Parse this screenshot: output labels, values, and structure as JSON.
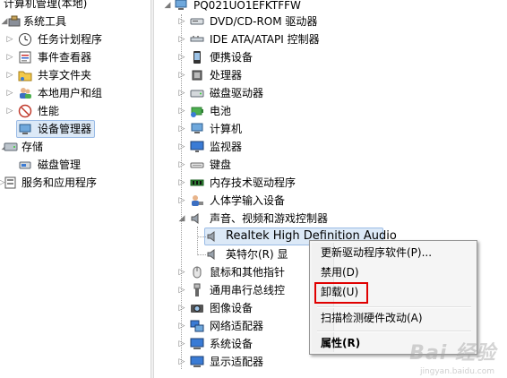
{
  "left_tree": {
    "title": "计算机管理(本地)",
    "items": [
      {
        "label": "系统工具",
        "arrow": "◢",
        "icon": "tools-icon"
      },
      {
        "label": "任务计划程序",
        "arrow": "▷",
        "icon": "clock-icon"
      },
      {
        "label": "事件查看器",
        "arrow": "▷",
        "icon": "event-viewer-icon"
      },
      {
        "label": "共享文件夹",
        "arrow": "▷",
        "icon": "shared-folder-icon"
      },
      {
        "label": "本地用户和组",
        "arrow": "▷",
        "icon": "users-icon"
      },
      {
        "label": "性能",
        "arrow": "▷",
        "icon": "performance-icon"
      },
      {
        "label": "设备管理器",
        "arrow": "",
        "icon": "device-manager-icon"
      },
      {
        "label": "存储",
        "arrow": "◢",
        "icon": "storage-icon"
      },
      {
        "label": "磁盘管理",
        "arrow": "",
        "icon": "disk-management-icon"
      },
      {
        "label": "服务和应用程序",
        "arrow": "▷",
        "icon": "services-icon"
      }
    ]
  },
  "device_tree": {
    "root": "PQ021UO1EFKTFFW",
    "items": [
      {
        "label": "DVD/CD-ROM 驱动器",
        "arrow": "▷",
        "icon": "dvd-drive-icon"
      },
      {
        "label": "IDE ATA/ATAPI 控制器",
        "arrow": "▷",
        "icon": "ide-controller-icon"
      },
      {
        "label": "便携设备",
        "arrow": "▷",
        "icon": "portable-device-icon"
      },
      {
        "label": "处理器",
        "arrow": "▷",
        "icon": "processor-icon"
      },
      {
        "label": "磁盘驱动器",
        "arrow": "▷",
        "icon": "disk-drive-icon"
      },
      {
        "label": "电池",
        "arrow": "▷",
        "icon": "battery-icon"
      },
      {
        "label": "计算机",
        "arrow": "▷",
        "icon": "computer-icon"
      },
      {
        "label": "监视器",
        "arrow": "▷",
        "icon": "monitor-icon"
      },
      {
        "label": "键盘",
        "arrow": "▷",
        "icon": "keyboard-icon"
      },
      {
        "label": "内存技术驱动程序",
        "arrow": "▷",
        "icon": "memory-icon"
      },
      {
        "label": "人体学输入设备",
        "arrow": "▷",
        "icon": "hid-icon"
      },
      {
        "label": "声音、视频和游戏控制器",
        "arrow": "◢",
        "icon": "sound-icon"
      },
      {
        "label": "Realtek High Definition Audio",
        "arrow": "",
        "icon": "speaker-icon"
      },
      {
        "label": "英特尔(R) 显",
        "arrow": "",
        "icon": "speaker-icon"
      },
      {
        "label": "鼠标和其他指针",
        "arrow": "▷",
        "icon": "mouse-icon"
      },
      {
        "label": "通用串行总线控",
        "arrow": "▷",
        "icon": "usb-icon"
      },
      {
        "label": "图像设备",
        "arrow": "▷",
        "icon": "camera-icon"
      },
      {
        "label": "网络适配器",
        "arrow": "▷",
        "icon": "network-icon"
      },
      {
        "label": "系统设备",
        "arrow": "▷",
        "icon": "system-device-icon"
      },
      {
        "label": "显示适配器",
        "arrow": "▷",
        "icon": "display-adapter-icon"
      }
    ]
  },
  "context_menu": {
    "update_driver": "更新驱动程序软件(P)...",
    "disable": "禁用(D)",
    "uninstall": "卸载(U)",
    "scan": "扫描检测硬件改动(A)",
    "properties": "属性(R)"
  },
  "watermark": {
    "text": "Bai 经验",
    "sub": "jingyan.baidu.com"
  },
  "colors": {
    "selection": "#dce9f7",
    "highlight_border": "#e00000"
  }
}
